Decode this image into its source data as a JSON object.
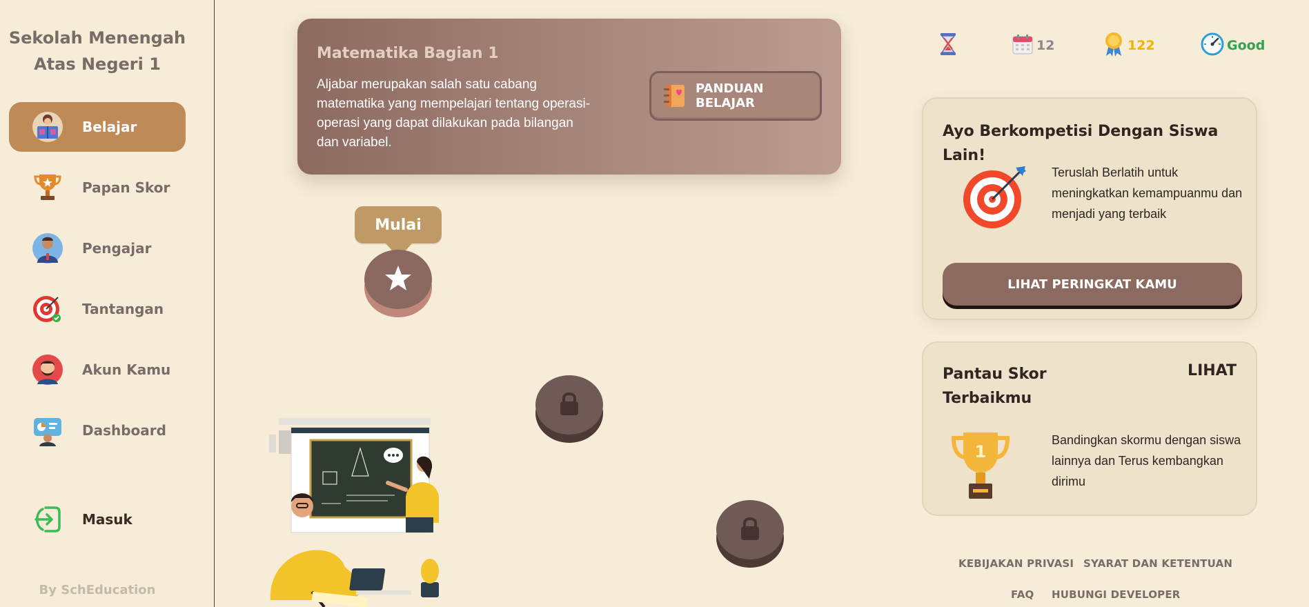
{
  "sidebar": {
    "school_name": "Sekolah Menengah Atas Negeri 1",
    "items": [
      {
        "label": "Belajar",
        "icon": "reading-student-icon",
        "active": true
      },
      {
        "label": "Papan Skor",
        "icon": "trophy-icon"
      },
      {
        "label": "Pengajar",
        "icon": "teacher-icon"
      },
      {
        "label": "Tantangan",
        "icon": "target-icon"
      },
      {
        "label": "Akun Kamu",
        "icon": "user-avatar-icon"
      },
      {
        "label": "Dashboard",
        "icon": "dashboard-icon"
      }
    ],
    "login": {
      "label": "Masuk",
      "icon": "login-arrow-icon"
    },
    "footer": "By SchEducation"
  },
  "banner": {
    "title": "Matematika Bagian 1",
    "description": "Aljabar merupakan salah satu cabang matematika yang mempelajari tentang operasi-operasi yang dapat dilakukan pada bilangan dan variabel.",
    "guide_button": "PANDUAN BELAJAR"
  },
  "path": {
    "start_tooltip": "Mulai"
  },
  "stats": {
    "hourglass_icon": "hourglass-icon",
    "calendar_value": "12",
    "medal_value": "122",
    "speed_value": "Good",
    "colors": {
      "medal": "#f0b400",
      "speed": "#2ea44f",
      "calendar": "#8a8a8a"
    }
  },
  "compete_card": {
    "title": "Ayo Berkompetisi Dengan Siswa Lain!",
    "text": "Teruslah Berlatih untuk meningkatkan kemampuanmu dan menjadi yang terbaik",
    "button": "LIHAT PERINGKAT KAMU"
  },
  "score_card": {
    "title": "Pantau Skor Terbaikmu",
    "link": "LIHAT",
    "trophy_number": "1",
    "text": "Bandingkan skormu dengan siswa lainnya dan Terus kembangkan dirimu"
  },
  "footer_links": [
    "KEBIJAKAN PRIVASI",
    "SYARAT DAN KETENTUAN",
    "FAQ",
    "HUBUNGI DEVELOPER"
  ],
  "colors": {
    "background": "#f6ecd8",
    "active_nav": "#be8a55",
    "primary_button": "#8c6a5f"
  }
}
